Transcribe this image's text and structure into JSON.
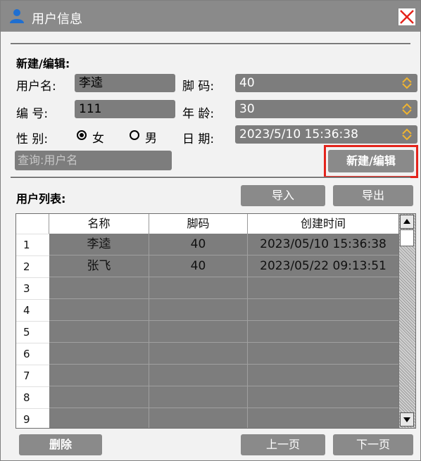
{
  "window": {
    "title": "用户信息"
  },
  "form": {
    "section_title": "新建/编辑:",
    "username_label": "用户名:",
    "username_value": "李逵",
    "shoe_size_label": "脚 码:",
    "shoe_size_value": "40",
    "id_label": "编 号:",
    "id_value": "111",
    "age_label": "年 龄:",
    "age_value": "30",
    "gender_label": "性 别:",
    "gender_female": "女",
    "gender_male": "男",
    "gender_selected": "女",
    "date_label": "日 期:",
    "date_value": "2023/5/10 15:36:38",
    "search_placeholder": "查询:用户名",
    "save_button": "新建/编辑"
  },
  "list": {
    "section_title": "用户列表:",
    "import_button": "导入",
    "export_button": "导出",
    "columns": [
      "名称",
      "脚码",
      "创建时间"
    ],
    "rows": [
      {
        "num": "1",
        "name": "李逵",
        "size": "40",
        "created": "2023/05/10 15:36:38"
      },
      {
        "num": "2",
        "name": "张飞",
        "size": "40",
        "created": "2023/05/22 09:13:51"
      },
      {
        "num": "3",
        "name": "",
        "size": "",
        "created": ""
      },
      {
        "num": "4",
        "name": "",
        "size": "",
        "created": ""
      },
      {
        "num": "5",
        "name": "",
        "size": "",
        "created": ""
      },
      {
        "num": "6",
        "name": "",
        "size": "",
        "created": ""
      },
      {
        "num": "7",
        "name": "",
        "size": "",
        "created": ""
      },
      {
        "num": "8",
        "name": "",
        "size": "",
        "created": ""
      },
      {
        "num": "9",
        "name": "",
        "size": "",
        "created": ""
      }
    ],
    "delete_button": "删除",
    "prev_button": "上一页",
    "next_button": "下一页"
  },
  "icons": {
    "title_icon": "user-icon",
    "close_icon": "close-icon",
    "spin_icon": "spin-updown-icon"
  },
  "colors": {
    "accent_highlight": "#e4231b",
    "titlebar": "#8a8a8a",
    "field_bg": "#7d7d7d",
    "user_icon": "#1f6fd1",
    "spin_icon": "#f0b430"
  }
}
